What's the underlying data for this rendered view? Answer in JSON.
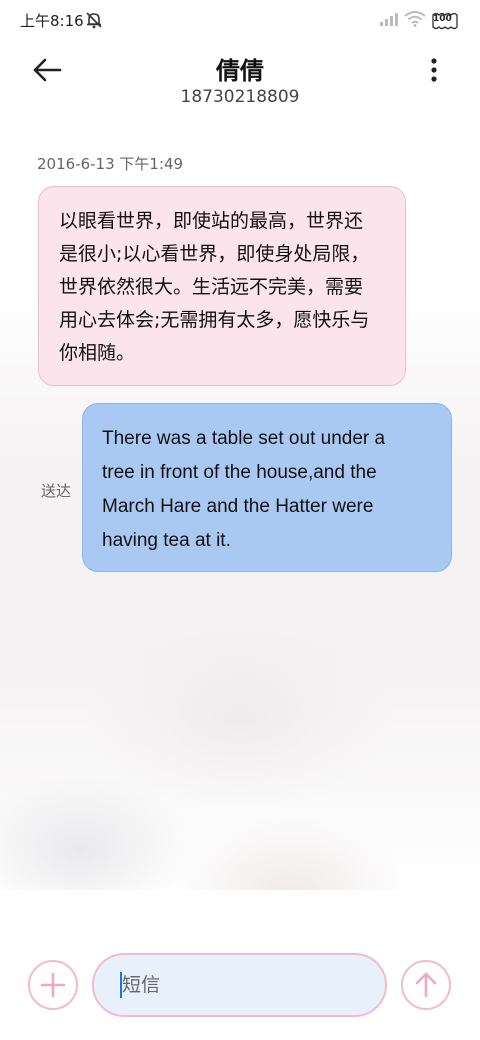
{
  "status_bar": {
    "time": "上午8:16",
    "battery_level": "100"
  },
  "header": {
    "contact_name": "倩倩",
    "contact_number": "18730218809"
  },
  "conversation": {
    "timestamp": "2016-6-13 下午1:49",
    "incoming_message": {
      "lines": [
        "以眼看世界，即使站的最高，世界还",
        "是很小;以心看世界，即使身处局限，",
        "世界依然很大。生活远不完美，需要",
        "用心去体会;无需拥有太多，愿快乐与",
        "你相随。"
      ]
    },
    "outgoing_message": {
      "lines": [
        "There was a table set out under a",
        "tree in front of the house,and the",
        "March Hare and the Hatter were",
        "having tea at it."
      ],
      "status": "送达"
    }
  },
  "composer": {
    "placeholder": "短信"
  },
  "colors": {
    "incoming_bubble": "#fce4ec",
    "outgoing_bubble": "#a9c9f2",
    "accent_border": "#f4b9cd"
  },
  "icons": {
    "back": "arrow-left-icon",
    "more": "more-vertical-icon",
    "add": "plus-icon",
    "send": "arrow-up-icon",
    "mute": "mute-bell-icon",
    "signal": "signal-icon",
    "wifi": "wifi-icon",
    "battery": "battery-icon"
  }
}
